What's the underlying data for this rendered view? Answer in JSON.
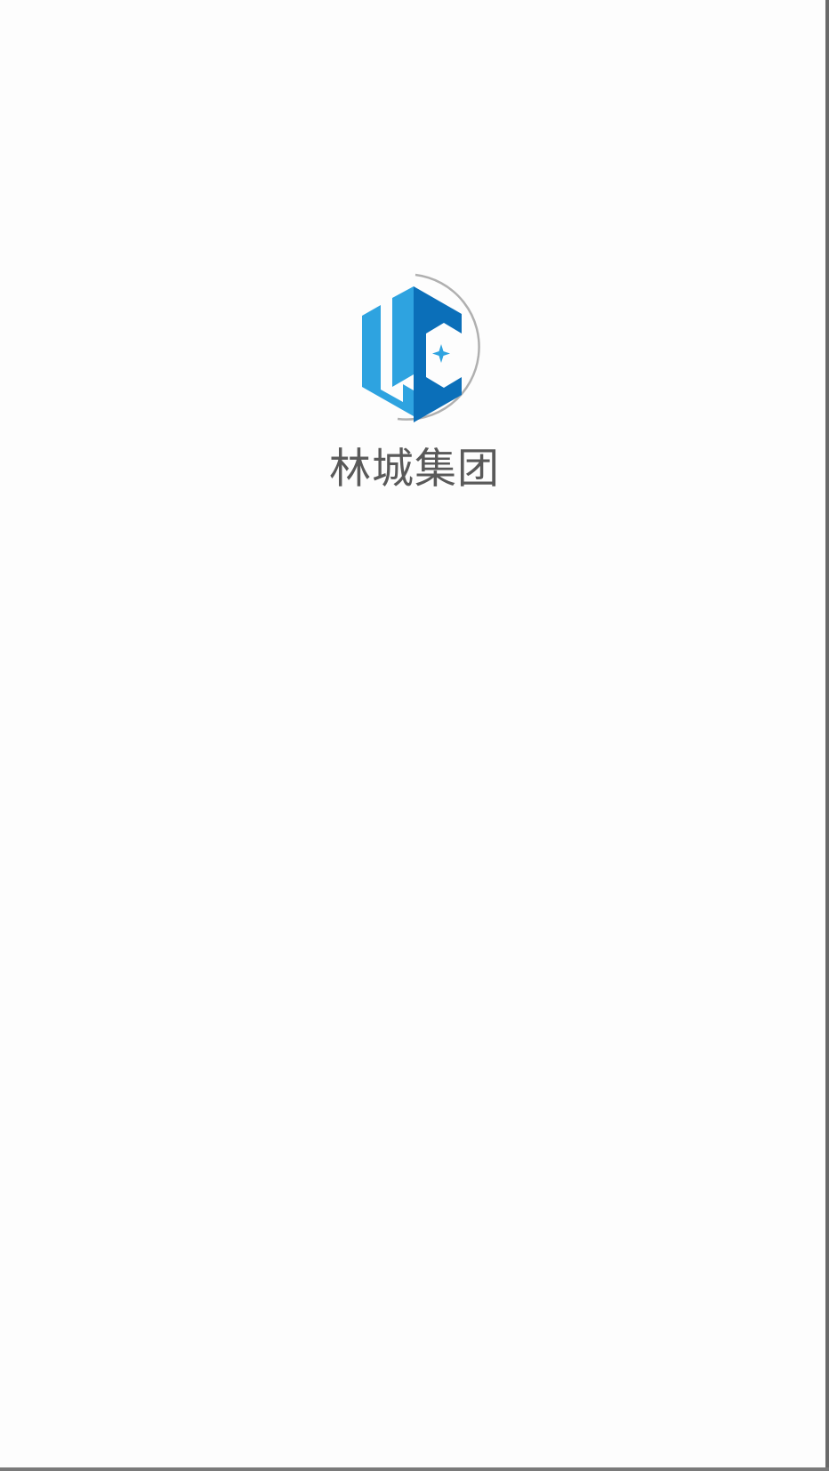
{
  "splash": {
    "brand_name": "林城集团",
    "logo_icon": "lc-hexagon-logo-icon",
    "colors": {
      "logo_light_blue": "#2ea3e0",
      "logo_dark_blue": "#0b6fb9",
      "logo_ring": "#b0b0b0",
      "text": "#595959",
      "background": "#fdfdfd"
    }
  }
}
